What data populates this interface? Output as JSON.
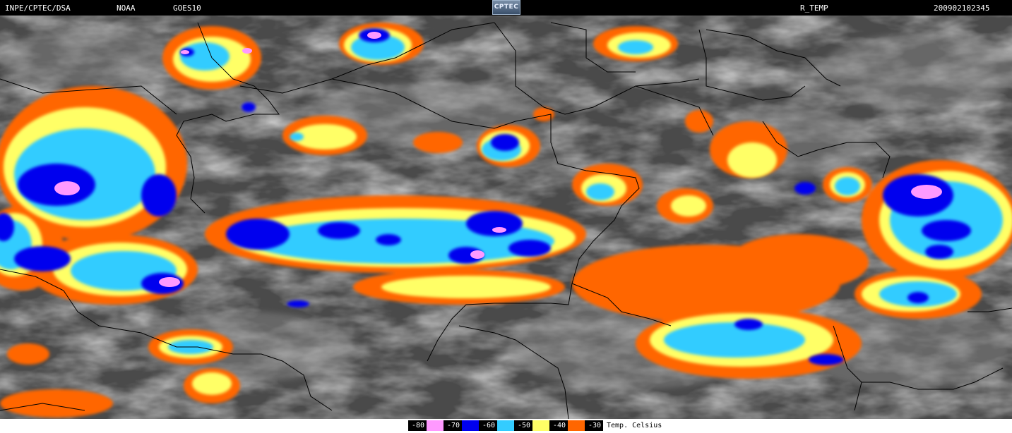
{
  "header": {
    "source": "INPE/CPTEC/DSA",
    "agency": "NOAA",
    "satellite": "GOES10",
    "logo_text": "CPTEC",
    "product": "R_TEMP",
    "timestamp": "200902102345"
  },
  "legend": {
    "items": [
      {
        "value": "-80",
        "color": "#ff99ff"
      },
      {
        "value": "-70",
        "color": "#0000ee"
      },
      {
        "value": "-60",
        "color": "#33ccff"
      },
      {
        "value": "-50",
        "color": "#ffff66"
      },
      {
        "value": "-40",
        "color": "#ff6600"
      },
      {
        "value": "-30",
        "color": "#000000"
      }
    ],
    "unit": "Temp. Celsius"
  },
  "colors": {
    "background_cloud_gray": "#4a4a4a",
    "border_lines": "#000000"
  }
}
